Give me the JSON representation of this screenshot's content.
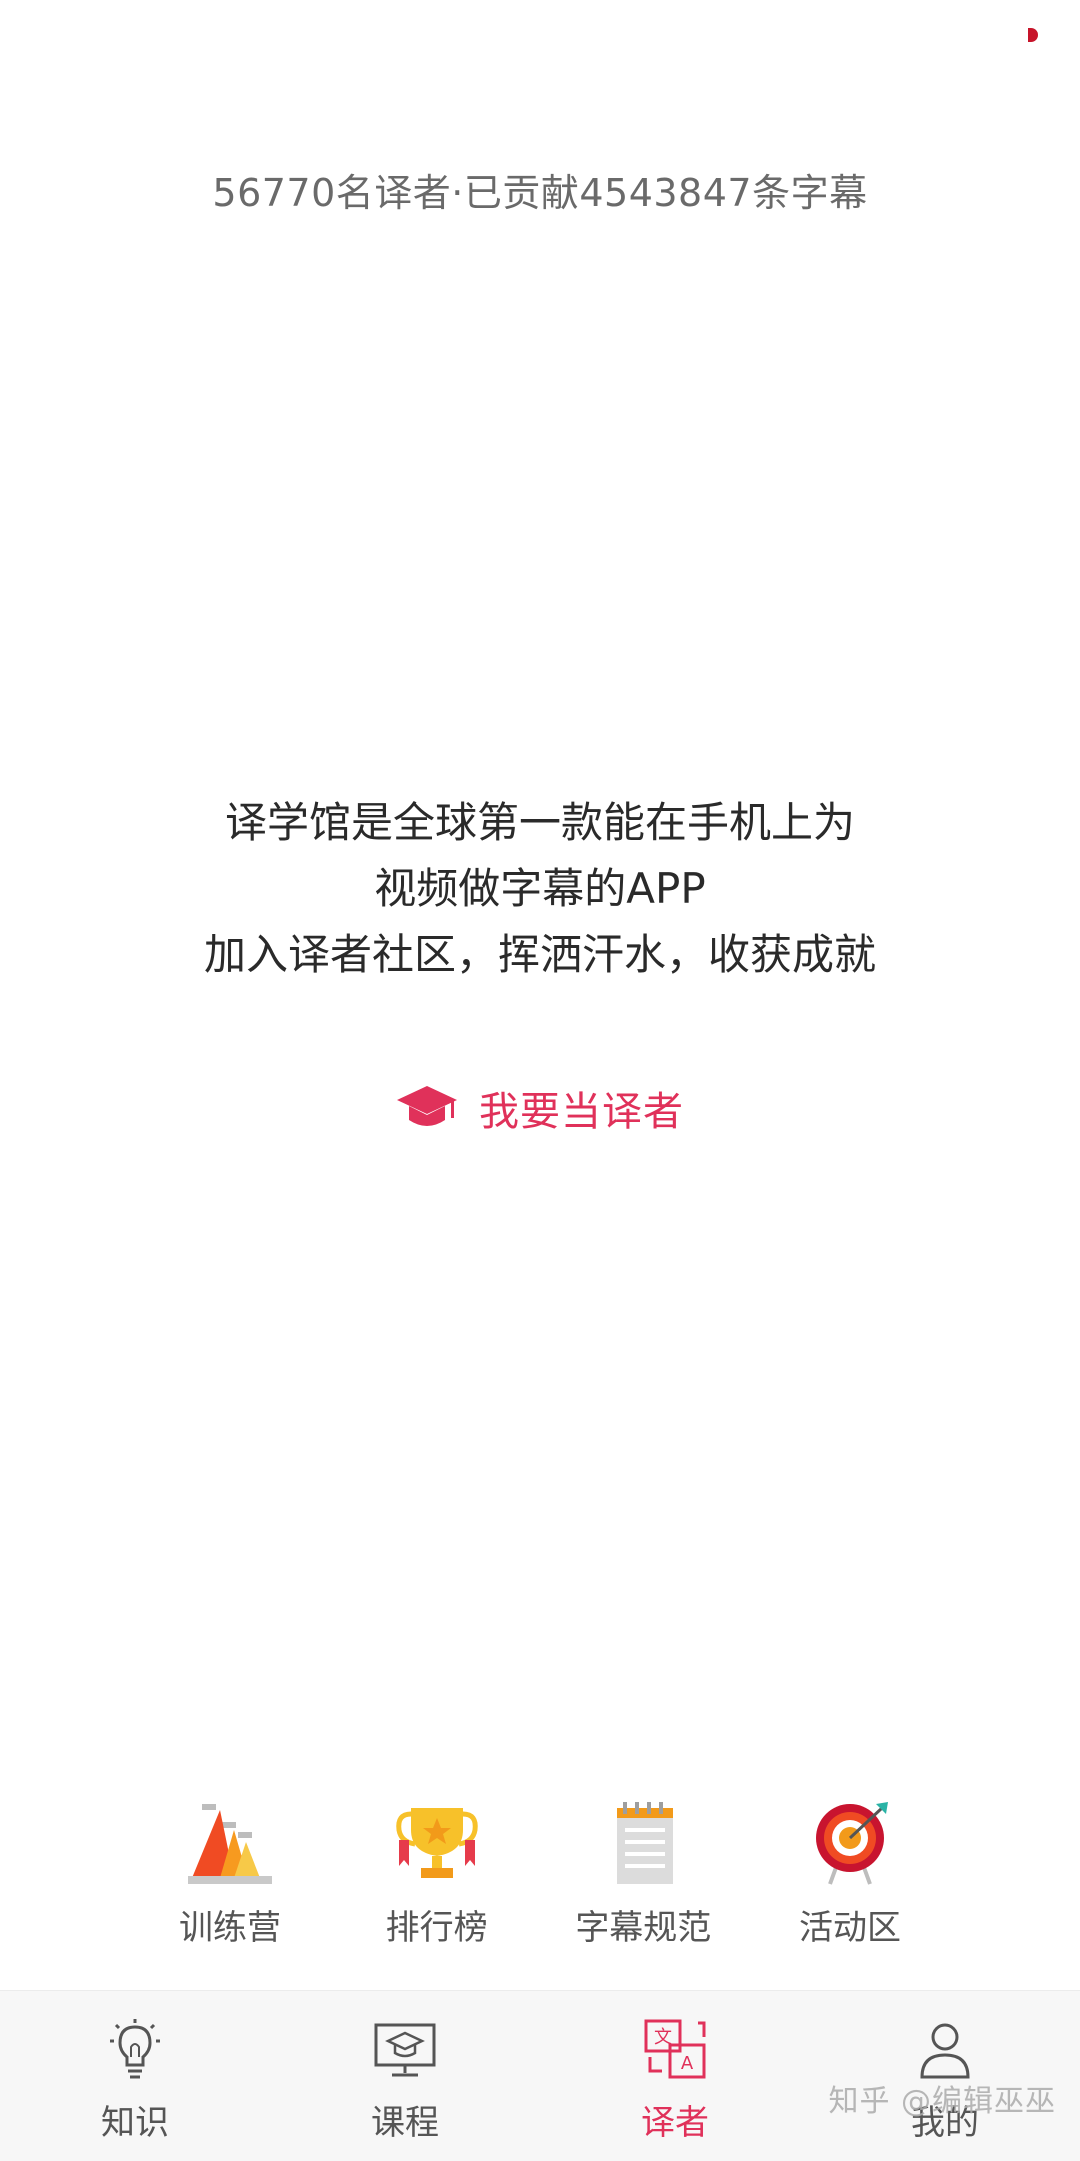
{
  "stats_text": "56770名译者·已贡献4543847条字幕",
  "intro": {
    "line1": "译学馆是全球第一款能在手机上为",
    "line2": "视频做字幕的APP",
    "line3": "加入译者社区，挥洒汗水，收获成就"
  },
  "become_translator": {
    "label": "我要当译者",
    "icon": "graduation-cap-icon"
  },
  "features": [
    {
      "label": "训练营",
      "icon": "training-camp-icon"
    },
    {
      "label": "排行榜",
      "icon": "trophy-icon"
    },
    {
      "label": "字幕规范",
      "icon": "notepad-icon"
    },
    {
      "label": "活动区",
      "icon": "target-icon"
    }
  ],
  "nav": {
    "items": [
      {
        "label": "知识",
        "icon": "lightbulb-icon"
      },
      {
        "label": "课程",
        "icon": "course-monitor-icon"
      },
      {
        "label": "译者",
        "icon": "translate-icon"
      },
      {
        "label": "我的",
        "icon": "user-icon"
      }
    ],
    "active_index": 2
  },
  "watermark": "知乎 @编辑巫巫",
  "colors": {
    "accent": "#e0315a",
    "text_primary": "#2a2a2a",
    "text_secondary": "#6a6a6a",
    "nav_bg": "#f7f7f7"
  }
}
